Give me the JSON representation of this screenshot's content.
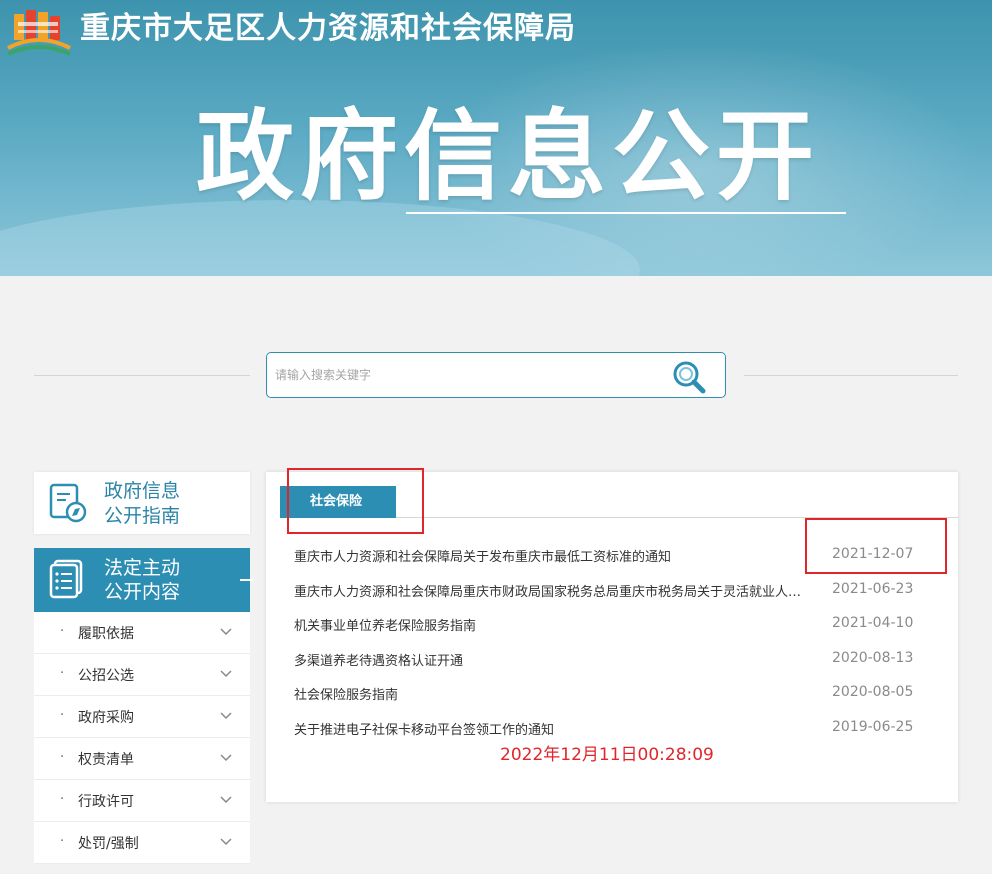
{
  "header": {
    "org_title": "重庆市大足区人力资源和社会保障局",
    "big_title": "政府信息公开"
  },
  "search": {
    "placeholder": "请输入搜索关键字",
    "icon": "search-icon"
  },
  "sidebar": {
    "guide": {
      "label_line1": "政府信息",
      "label_line2": "公开指南",
      "icon": "compass-document-icon"
    },
    "active": {
      "label_line1": "法定主动",
      "label_line2": "公开内容",
      "icon": "list-document-icon",
      "collapse_symbol": "—"
    },
    "items": [
      {
        "label": "履职依据"
      },
      {
        "label": "公招公选"
      },
      {
        "label": "政府采购"
      },
      {
        "label": "权责清单"
      },
      {
        "label": "行政许可"
      },
      {
        "label": "处罚/强制"
      }
    ],
    "bullet": "·"
  },
  "panel": {
    "tab_label": "社会保险",
    "news": [
      {
        "title": "重庆市人力资源和社会保障局关于发布重庆市最低工资标准的通知",
        "date": "2021-12-07"
      },
      {
        "title": "重庆市人力资源和社会保障局重庆市财政局国家税务总局重庆市税务局关于灵活就业人员参加企业职工基本养老保险有关问题的通知",
        "date": "2021-06-23"
      },
      {
        "title": "机关事业单位养老保险服务指南",
        "date": "2021-04-10"
      },
      {
        "title": "多渠道养老待遇资格认证开通",
        "date": "2020-08-13"
      },
      {
        "title": "社会保险服务指南",
        "date": "2020-08-05"
      },
      {
        "title": "关于推进电子社保卡移动平台签领工作的通知",
        "date": "2019-06-25"
      }
    ]
  },
  "annotation": {
    "timestamp": "2022年12月11日00:28:09",
    "color": "#e0262b"
  },
  "colors": {
    "accent": "#2d8eb3",
    "banner": "#3d93ad"
  }
}
